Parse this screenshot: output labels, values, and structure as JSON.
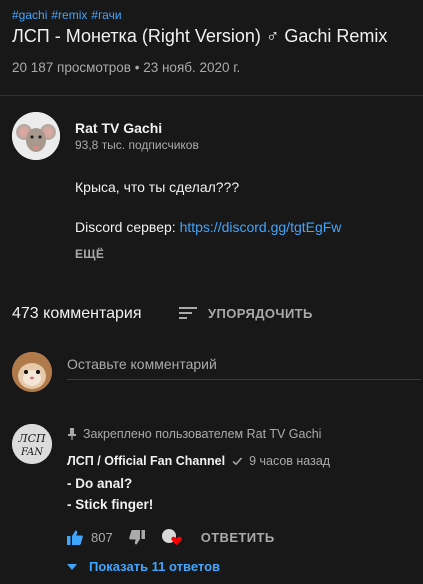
{
  "video": {
    "hashtags": [
      "#gachi",
      "#remix",
      "#гачи"
    ],
    "title": "ЛСП - Монетка (Right Version) ♂ Gachi Remix",
    "meta": "20 187 просмотров • 23 нояб. 2020 г."
  },
  "channel": {
    "name": "Rat TV Gachi",
    "subscribers": "93,8 тыс. подписчиков",
    "avatar_icon": "rat-icon"
  },
  "description": {
    "line1": "Крыса, что ты сделал???",
    "line2_prefix": "Discord сервер: ",
    "line2_link": "https://discord.gg/tgtEgFw",
    "more_label": "ЕЩЁ"
  },
  "comments": {
    "count_label": "473 комментария",
    "sort_label": "УПОРЯДОЧИТЬ",
    "sort_icon": "sort-icon",
    "add_placeholder": "Оставьте комментарий"
  },
  "pinned_comment": {
    "pinned_label": "Закреплено пользователем Rat TV Gachi",
    "author": "ЛСП / Official Fan Channel",
    "avatar_text": "ЛСП FAN",
    "time": "9 часов назад",
    "text_lines": [
      "- Do anal?",
      "- Stick finger!"
    ],
    "likes": "807",
    "reply_label": "ОТВЕТИТЬ",
    "show_replies_label": "Показать 11 ответов"
  },
  "colors": {
    "background": "#181818",
    "link": "#3ea6ff",
    "secondary_text": "#aaaaaa",
    "heart": "#ff0000"
  }
}
